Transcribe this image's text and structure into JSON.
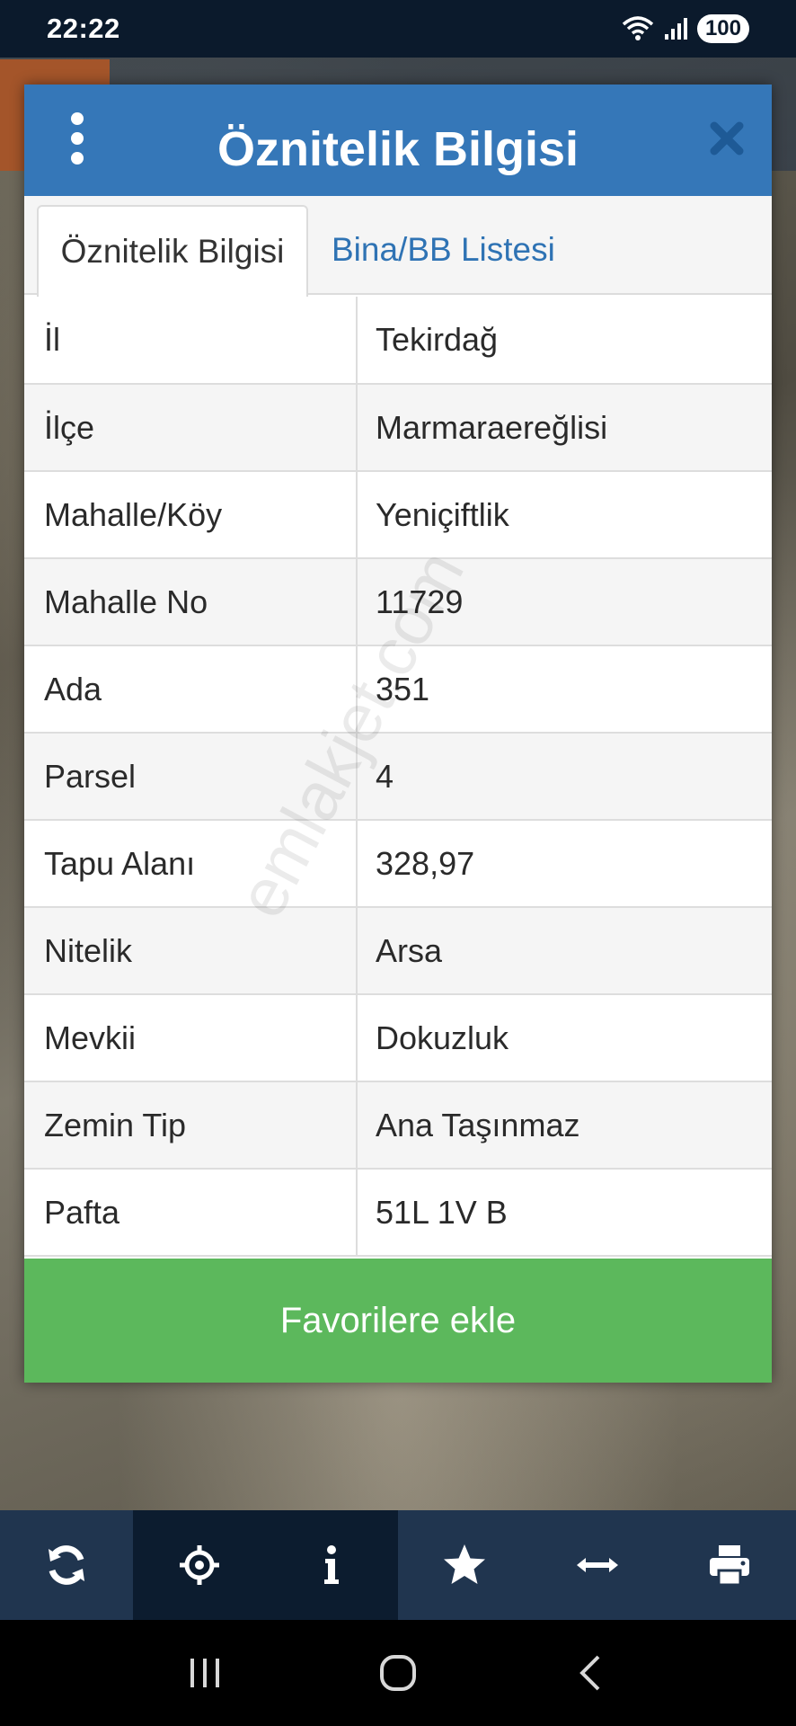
{
  "status_bar": {
    "time": "22:22",
    "battery": "100"
  },
  "dialog": {
    "title": "Öznitelik Bilgisi",
    "tabs": [
      {
        "label": "Öznitelik Bilgisi",
        "active": true
      },
      {
        "label": "Bina/BB Listesi",
        "active": false
      }
    ],
    "rows": [
      {
        "key": "İl",
        "value": "Tekirdağ"
      },
      {
        "key": "İlçe",
        "value": "Marmaraereğlisi"
      },
      {
        "key": "Mahalle/Köy",
        "value": "Yeniçiftlik"
      },
      {
        "key": "Mahalle No",
        "value": "11729"
      },
      {
        "key": "Ada",
        "value": "351"
      },
      {
        "key": "Parsel",
        "value": "4"
      },
      {
        "key": "Tapu Alanı",
        "value": "328,97"
      },
      {
        "key": "Nitelik",
        "value": "Arsa"
      },
      {
        "key": "Mevkii",
        "value": "Dokuzluk"
      },
      {
        "key": "Zemin Tip",
        "value": "Ana Taşınmaz"
      },
      {
        "key": "Pafta",
        "value": "51L 1V B"
      }
    ],
    "favorite_button": "Favorilere ekle"
  },
  "watermark": "emlakjet.com",
  "toolbar": {
    "icons": [
      "refresh-icon",
      "locate-icon",
      "info-icon",
      "star-icon",
      "measure-icon",
      "print-icon"
    ]
  },
  "colors": {
    "header_blue": "#3577b8",
    "tab_link_blue": "#2f73b4",
    "button_green": "#5cb85c",
    "toolbar": "#20354f"
  }
}
